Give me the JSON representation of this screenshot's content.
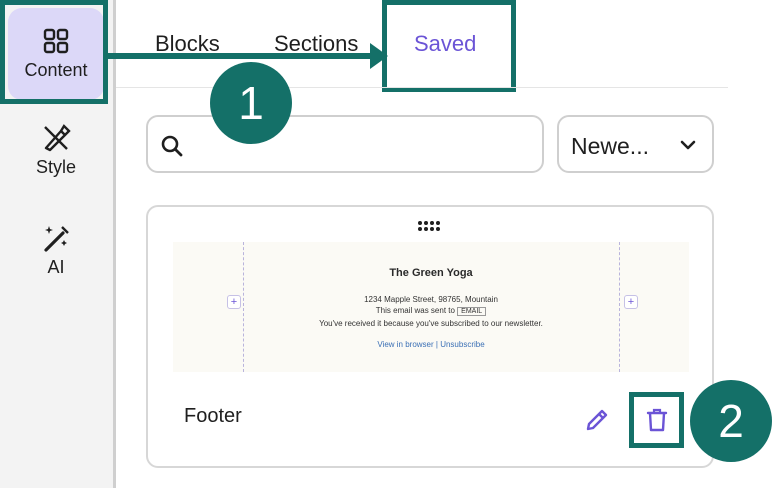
{
  "sidebar": {
    "items": [
      {
        "label": "Content",
        "icon": "grid-icon"
      },
      {
        "label": "Style",
        "icon": "brush-icon"
      },
      {
        "label": "AI",
        "icon": "magic-wand-icon"
      }
    ]
  },
  "tabs": [
    {
      "label": "Blocks"
    },
    {
      "label": "Sections"
    },
    {
      "label": "Saved",
      "active": true
    }
  ],
  "search": {
    "placeholder": "",
    "icon": "search-icon"
  },
  "sort": {
    "value": "Newe..."
  },
  "card": {
    "name": "Footer",
    "preview": {
      "title": "The Green Yoga",
      "address": "1234 Mapple Street, 98765, Mountain",
      "sent_prefix": "This email was sent to",
      "sent_tag": "EMAIL",
      "reason": "You've received it because you've subscribed to our newsletter.",
      "links": "View in browser | Unsubscribe"
    }
  },
  "annotations": {
    "step1": "1",
    "step2": "2"
  },
  "colors": {
    "accent": "#6b54d6",
    "callout": "#147068",
    "active_bg": "#dcd8f8"
  }
}
